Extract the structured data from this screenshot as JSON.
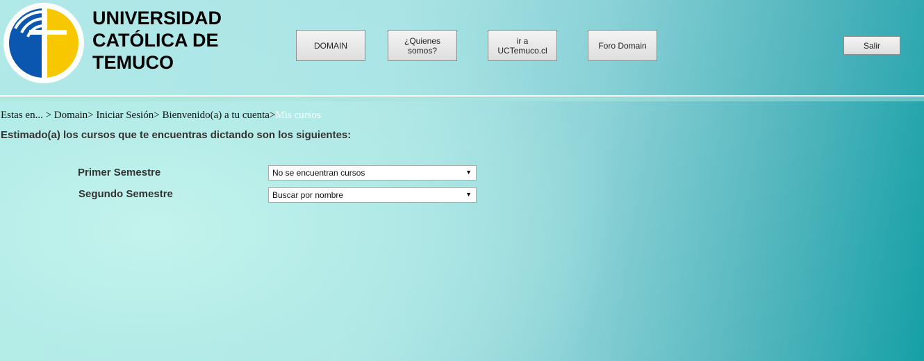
{
  "university": {
    "name_lines": [
      "UNIVERSIDAD",
      "CATÓLICA DE",
      "TEMUCO"
    ]
  },
  "logo": {
    "icon": "uct-cross-logo-icon",
    "colors": {
      "blue": "#0b57b0",
      "yellow": "#f7c700",
      "ring": "#ffffff"
    }
  },
  "nav": {
    "buttons": [
      {
        "label": "DOMAIN"
      },
      {
        "label": "¿Quienes somos?"
      },
      {
        "label": "ir a UCTemuco.cl"
      },
      {
        "label": "Foro Domain"
      }
    ],
    "logout_label": "Salir"
  },
  "breadcrumb": {
    "items": [
      "Estas en... >",
      "Domain>",
      "Iniciar Sesión>",
      "Bienvenido(a) a tu cuenta>"
    ],
    "current": "Mis cursos"
  },
  "main": {
    "intro": "Estimado(a) los cursos que te encuentras dictando son los siguientes:",
    "semesters": [
      {
        "label": "Primer Semestre",
        "selected": "No se encuentran cursos"
      },
      {
        "label": "Segundo Semestre",
        "selected": "Buscar por nombre"
      }
    ]
  }
}
